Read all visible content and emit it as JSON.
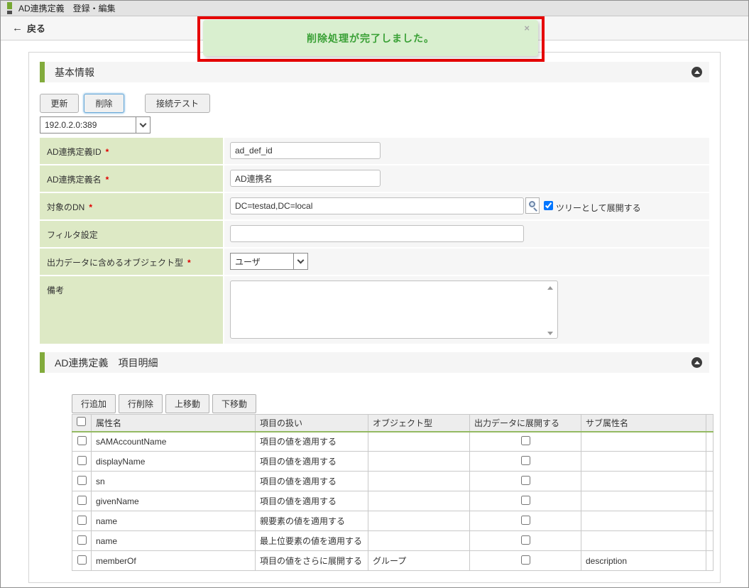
{
  "titlebar": {
    "title": "AD連携定義　登録・編集"
  },
  "toolbar": {
    "back_label": "戻る"
  },
  "notification": {
    "message": "削除処理が完了しました。",
    "close_icon": "×",
    "text_color": "#39a035",
    "bg_color": "#d9efcf",
    "highlight_border_color": "#e60000"
  },
  "basic_section": {
    "title": "基本情報",
    "required_mark": "*",
    "buttons": {
      "update": "更新",
      "delete": "削除",
      "connection_test": "接続テスト"
    },
    "server_select": {
      "value": "192.0.2.0:389"
    },
    "fields": [
      {
        "label": "AD連携定義ID",
        "required": true,
        "value": "ad_def_id"
      },
      {
        "label": "AD連携定義名",
        "required": true,
        "value": "AD連携名"
      },
      {
        "label": "対象のDN",
        "required": true,
        "value": "DC=testad,DC=local",
        "checkbox_label": "ツリーとして展開する",
        "checkbox_checked": true
      },
      {
        "label": "フィルタ設定",
        "required": false,
        "value": ""
      },
      {
        "label": "出力データに含めるオブジェクト型",
        "required": true,
        "value": "ユーザ"
      },
      {
        "label": "備考",
        "required": false,
        "value": ""
      }
    ]
  },
  "detail_section": {
    "title": "AD連携定義　項目明細",
    "buttons": {
      "add_row": "行追加",
      "delete_row": "行削除",
      "move_up": "上移動",
      "move_down": "下移動"
    },
    "table": {
      "headers": [
        "属性名",
        "項目の扱い",
        "オブジェクト型",
        "出力データに展開する",
        "サブ属性名"
      ],
      "rows": [
        {
          "attribute": "sAMAccountName",
          "handling": "項目の値を適用する",
          "object_type": "",
          "expand_checked": false,
          "sub_attribute": ""
        },
        {
          "attribute": "displayName",
          "handling": "項目の値を適用する",
          "object_type": "",
          "expand_checked": false,
          "sub_attribute": ""
        },
        {
          "attribute": "sn",
          "handling": "項目の値を適用する",
          "object_type": "",
          "expand_checked": false,
          "sub_attribute": ""
        },
        {
          "attribute": "givenName",
          "handling": "項目の値を適用する",
          "object_type": "",
          "expand_checked": false,
          "sub_attribute": ""
        },
        {
          "attribute": "name",
          "handling": "親要素の値を適用する",
          "object_type": "",
          "expand_checked": false,
          "sub_attribute": ""
        },
        {
          "attribute": "name",
          "handling": "最上位要素の値を適用する",
          "object_type": "",
          "expand_checked": false,
          "sub_attribute": ""
        },
        {
          "attribute": "memberOf",
          "handling": "項目の値をさらに展開する",
          "object_type": "グループ",
          "expand_checked": false,
          "sub_attribute": "description"
        }
      ]
    }
  }
}
